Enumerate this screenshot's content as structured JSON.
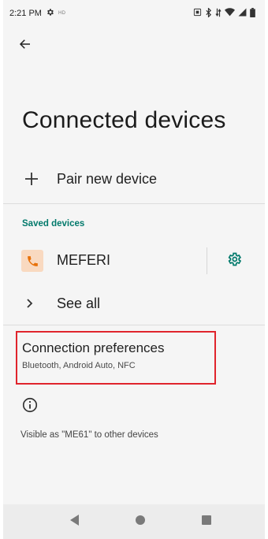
{
  "status_bar": {
    "time": "2:21 PM",
    "hd_label": "HD",
    "icons": [
      "gear-icon",
      "nfc-icon",
      "bluetooth-icon",
      "data-arrows-icon",
      "wifi-icon",
      "signal-icon",
      "battery-icon"
    ]
  },
  "header": {
    "back_icon": "arrow-left-icon",
    "title": "Connected devices"
  },
  "pair_new_device": {
    "icon": "plus-icon",
    "label": "Pair new device"
  },
  "saved_devices": {
    "section_label": "Saved devices",
    "devices": [
      {
        "name": "MEFERI",
        "icon": "phone-icon",
        "settings_icon": "gear-icon"
      }
    ],
    "see_all_label": "See all"
  },
  "connection_preferences": {
    "title": "Connection preferences",
    "subtitle": "Bluetooth, Android Auto, NFC"
  },
  "info": {
    "icon": "info-icon",
    "visible_as": "Visible as \"ME61\" to other devices"
  },
  "nav_bar": {
    "buttons": [
      "back-triangle-icon",
      "home-circle-icon",
      "recents-square-icon"
    ]
  },
  "colors": {
    "accent": "#00796b",
    "highlight_border": "#e0242c",
    "device_icon_bg": "#f9d9c0",
    "device_icon_fg": "#e8710a"
  }
}
